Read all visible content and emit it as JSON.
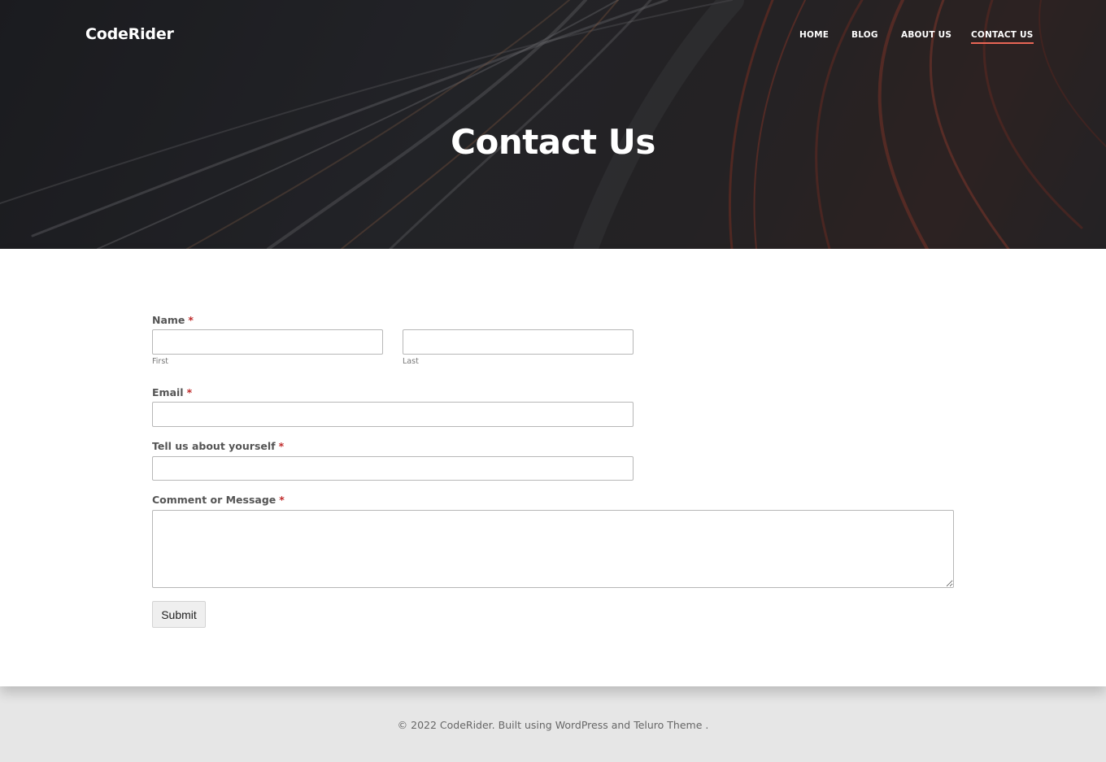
{
  "header": {
    "brand": "CodeRider",
    "nav": [
      {
        "label": "HOME"
      },
      {
        "label": "BLOG"
      },
      {
        "label": "ABOUT US"
      },
      {
        "label": "CONTACT US",
        "active": true
      }
    ],
    "accent_color": "#e96656"
  },
  "hero": {
    "title": "Contact Us"
  },
  "form": {
    "name": {
      "label": "Name",
      "required_mark": "*",
      "first_sublabel": "First",
      "last_sublabel": "Last",
      "first_value": "",
      "last_value": ""
    },
    "email": {
      "label": "Email",
      "required_mark": "*",
      "value": ""
    },
    "about": {
      "label": "Tell us about yourself",
      "required_mark": "*",
      "value": ""
    },
    "message": {
      "label": "Comment or Message",
      "required_mark": "*",
      "value": ""
    },
    "submit_label": "Submit",
    "required_color": "#c02b2b"
  },
  "footer": {
    "prefix": "© 2022 CodeRider. Built using ",
    "link1": "WordPress",
    "middle": " and ",
    "link2": "Teluro Theme",
    "suffix": " ."
  }
}
